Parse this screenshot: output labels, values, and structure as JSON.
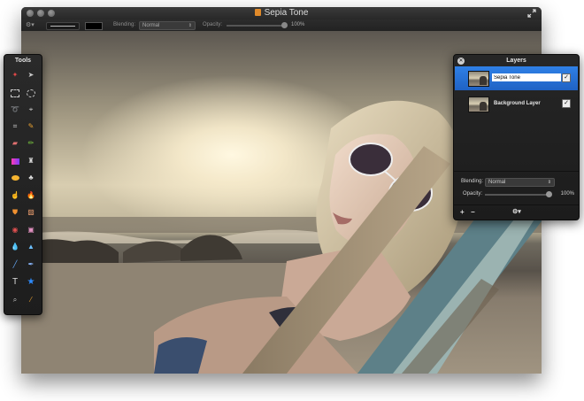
{
  "window": {
    "title": "Sepia Tone"
  },
  "options_bar": {
    "blending_label": "Blending:",
    "blending_value": "Normal",
    "opacity_label": "Opacity:",
    "opacity_value": "100%",
    "foreground_color": "#000000"
  },
  "tools_panel": {
    "title": "Tools",
    "tools": [
      "magic-wand",
      "pointer",
      "rect-marquee",
      "ellipse-marquee",
      "lasso",
      "polygon-lasso",
      "crop",
      "eyedropper",
      "eraser",
      "pencil",
      "gradient",
      "paint-bucket",
      "brush",
      "clone-stamp",
      "smudge",
      "burn",
      "stamp",
      "bandage",
      "red-eye",
      "sponge",
      "drop",
      "sharpen",
      "line",
      "pen",
      "type",
      "shape-star",
      "zoom",
      "color-picker"
    ]
  },
  "layers_panel": {
    "title": "Layers",
    "layers": [
      {
        "name": "Sepia Tone",
        "selected": true,
        "visible": true
      },
      {
        "name": "Background Layer",
        "selected": false,
        "visible": true
      }
    ],
    "blending_label": "Blending:",
    "blending_value": "Normal",
    "opacity_label": "Opacity:",
    "opacity_value": "100%",
    "add_button": "+",
    "remove_button": "−"
  },
  "colors": {
    "selection_blue": "#2a72d8",
    "panel_bg": "#1f1f1f"
  }
}
